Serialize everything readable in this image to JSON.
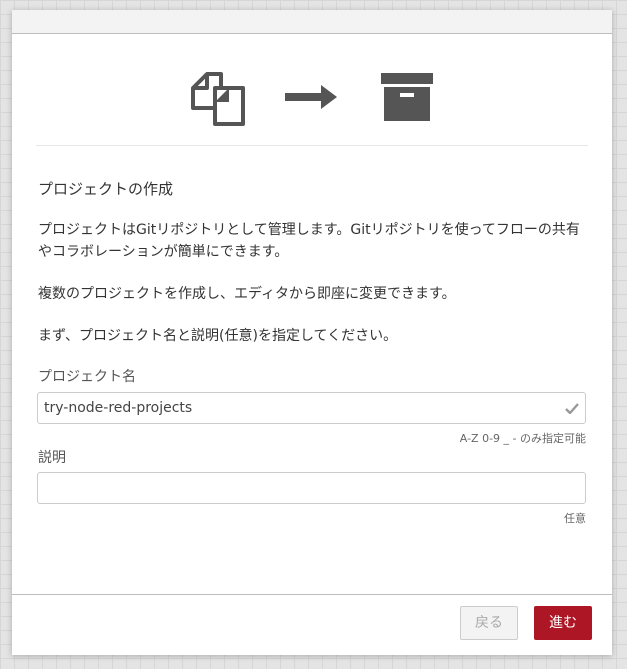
{
  "dialog": {
    "heading": "プロジェクトの作成",
    "paragraphs": [
      "プロジェクトはGitリポジトリとして管理します。Gitリポジトリを使ってフローの共有やコラボレーションが簡単にできます。",
      "複数のプロジェクトを作成し、エディタから即座に変更できます。",
      "まず、プロジェクト名と説明(任意)を指定してください。"
    ],
    "icons": {
      "copy": "copy-icon",
      "arrow": "arrow-right-icon",
      "archive": "archive-box-icon"
    },
    "colors": {
      "icon": "#555555",
      "primary_button": "#ad1625"
    }
  },
  "form": {
    "name_label": "プロジェクト名",
    "name_value": "try-node-red-projects",
    "name_hint": "A-Z 0-9 _ - のみ指定可能",
    "desc_label": "説明",
    "desc_value": "",
    "desc_hint": "任意"
  },
  "footer": {
    "back_label": "戻る",
    "next_label": "進む"
  }
}
